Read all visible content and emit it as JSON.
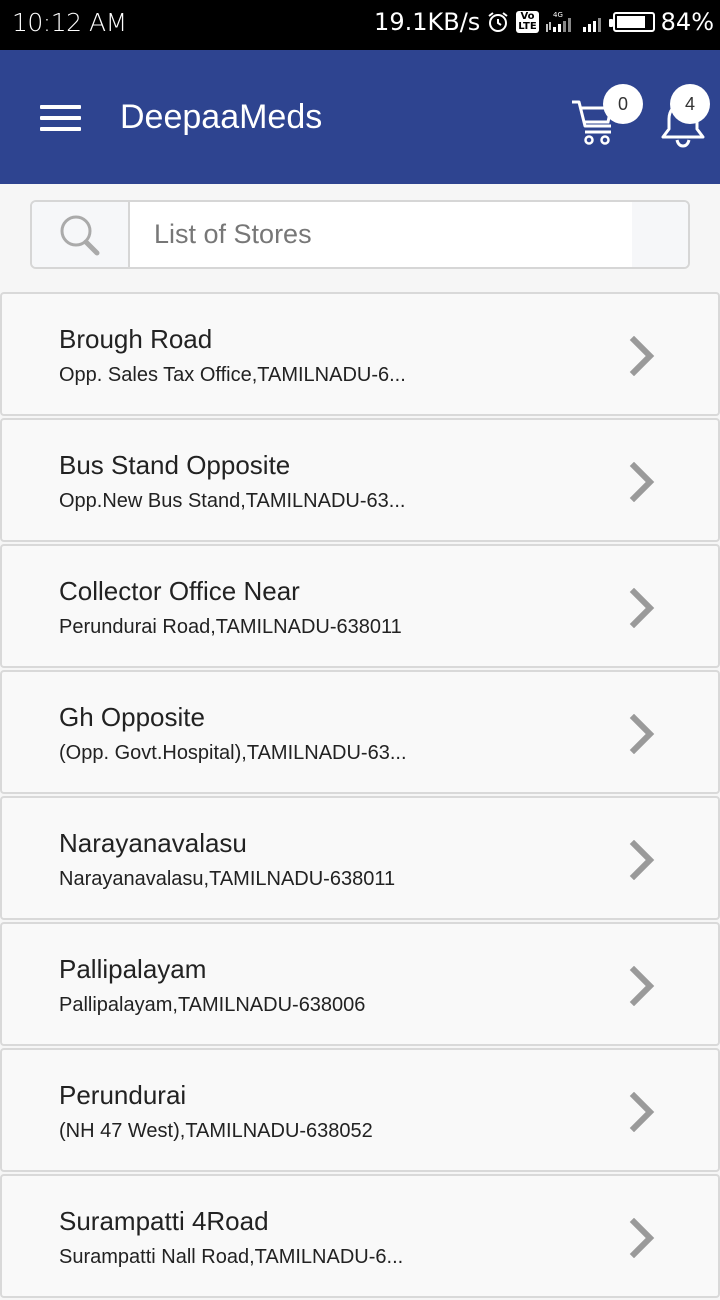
{
  "status_bar": {
    "time": "10:12 AM",
    "network_speed": "19.1KB/s",
    "icons": [
      "alarm-icon",
      "volte-icon",
      "signal-4g-icon",
      "signal-icon",
      "battery-icon"
    ],
    "volte_label": "Vo LTE",
    "battery_percent": "84%",
    "battery_level": 0.84
  },
  "app_bar": {
    "title": "DeepaaMeds",
    "menu_icon": "hamburger-menu-icon",
    "cart_icon": "cart-icon",
    "cart_count": "0",
    "notifications_icon": "bell-icon",
    "notifications_count": "4",
    "background_color": "#2e4490"
  },
  "search": {
    "icon": "search-icon",
    "placeholder": "List of Stores",
    "value": ""
  },
  "stores": [
    {
      "name": "Brough Road",
      "address": "Opp. Sales Tax Office,TAMILNADU-6..."
    },
    {
      "name": "Bus Stand Opposite",
      "address": "Opp.New Bus Stand,TAMILNADU-63..."
    },
    {
      "name": "Collector Office Near",
      "address": "Perundurai Road,TAMILNADU-638011"
    },
    {
      "name": "Gh Opposite",
      "address": "(Opp. Govt.Hospital),TAMILNADU-63..."
    },
    {
      "name": "Narayanavalasu",
      "address": "Narayanavalasu,TAMILNADU-638011"
    },
    {
      "name": "Pallipalayam",
      "address": "Pallipalayam,TAMILNADU-638006"
    },
    {
      "name": "Perundurai",
      "address": "(NH 47 West),TAMILNADU-638052"
    },
    {
      "name": "Surampatti 4Road",
      "address": "Surampatti Nall Road,TAMILNADU-6..."
    }
  ]
}
